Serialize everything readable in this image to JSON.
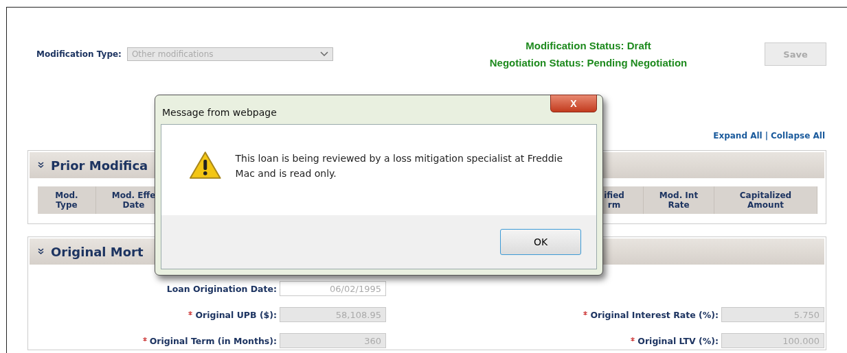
{
  "header": {
    "modification_type": {
      "label": "Modification Type:",
      "value": "Other modifications",
      "disabled": true
    },
    "statuses": [
      "Modification Status: Draft",
      "Negotiation Status: Pending Negotiation"
    ],
    "save_button": {
      "label": "Save",
      "disabled": true
    }
  },
  "links": [
    "Expand All",
    "|",
    "Collapse All"
  ],
  "prior_modifications": {
    "title": "Prior Modifica",
    "expanded": true,
    "columns": [
      {
        "lines": [
          "Mod.",
          "Type"
        ]
      },
      {
        "lines": [
          "Mod. Effe",
          "Date"
        ]
      },
      {
        "lines": [
          "ified",
          "rm"
        ]
      },
      {
        "lines": [
          "Mod. Int",
          "Rate"
        ]
      },
      {
        "lines": [
          "Capitalized",
          "Amount"
        ]
      }
    ]
  },
  "original_mortgage": {
    "title": "Original Mort",
    "expanded": true,
    "rows": [
      {
        "left": {
          "label": "Loan Origination Date:",
          "value": "06/02/1995",
          "required": false
        }
      },
      {
        "left": {
          "label": "Original UPB ($):",
          "value": "58,108.95",
          "required": true
        },
        "right": {
          "label": "Original Interest Rate (%):",
          "value": "5.750",
          "required": true
        }
      },
      {
        "left": {
          "label": "Original Term (in Months):",
          "value": "360",
          "required": true
        },
        "right": {
          "label": "Original LTV (%):",
          "value": "100.000",
          "required": true
        }
      }
    ]
  },
  "dialog": {
    "title": "Message from webpage",
    "message": "This loan is being reviewed by a loss mitigation specialist at Freddie Mac and is read only.",
    "close": "X",
    "buttons": [
      "OK"
    ]
  }
}
